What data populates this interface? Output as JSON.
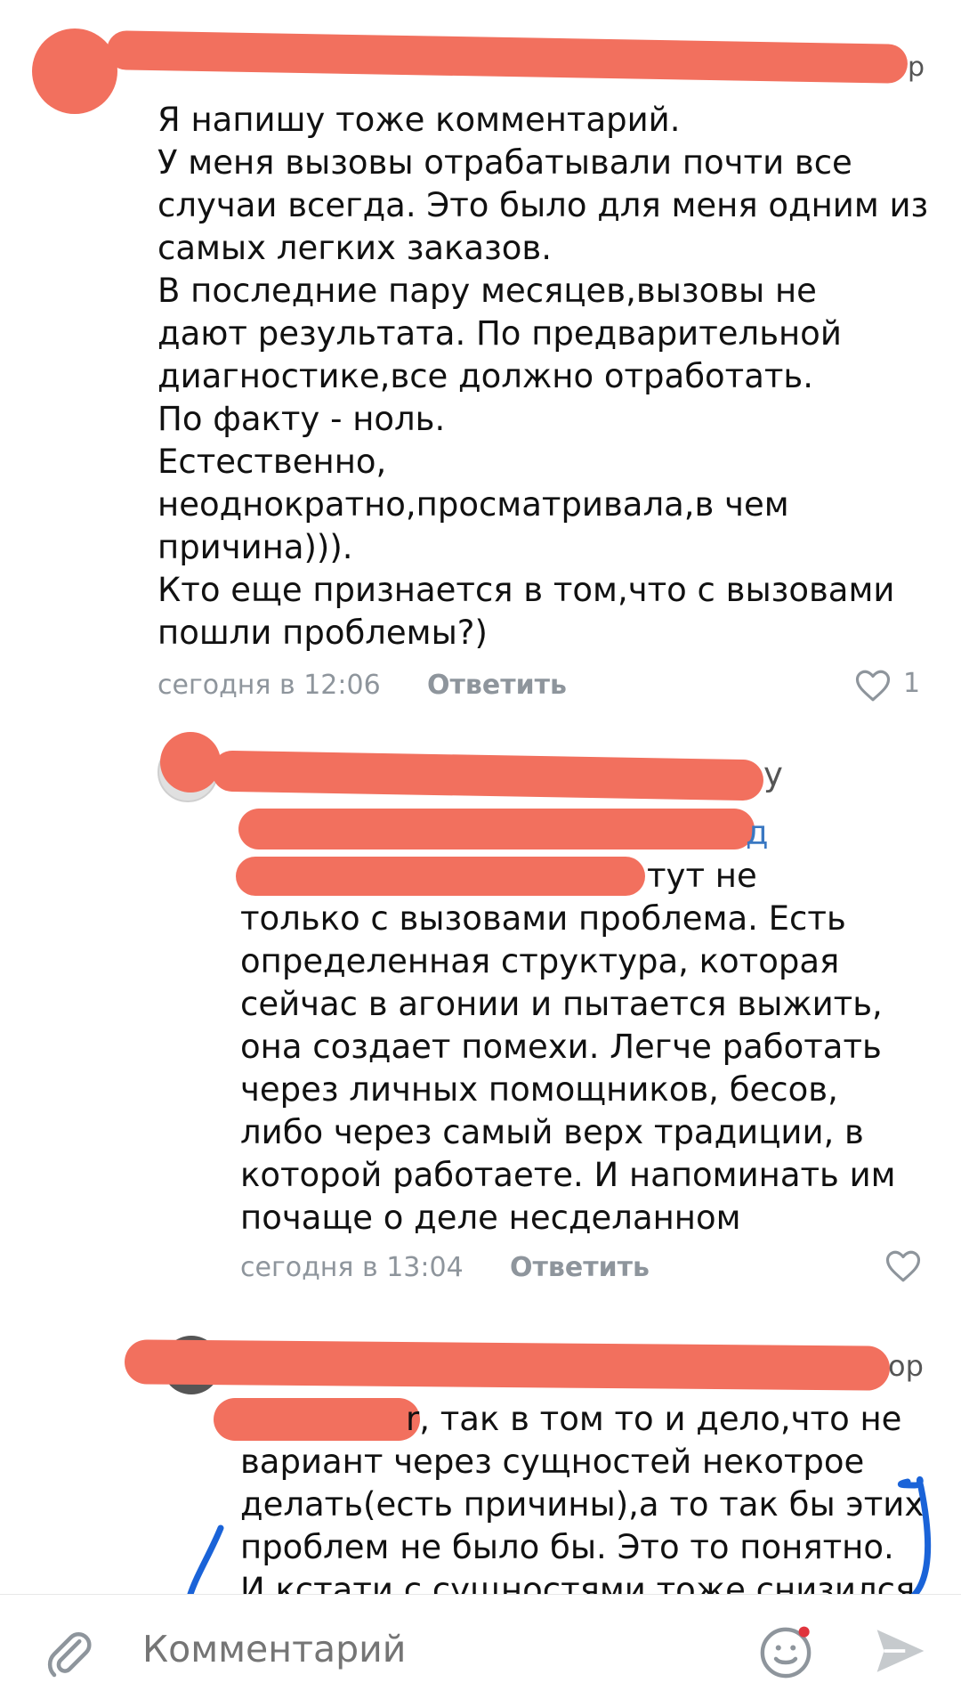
{
  "colors": {
    "redaction": "#f2705e",
    "meta": "#8e959c",
    "annotation": "#1a63d8",
    "heart": "#8e959c"
  },
  "comments": [
    {
      "author_suffix": "р",
      "text_lines": [
        "Я напишу тоже комментарий.",
        "У меня вызовы отрабатывали почти все",
        "случаи всегда. Это было для меня одним из",
        "самых легких заказов.",
        "В последние пару месяцев,вызовы не",
        "дают результата. По предварительной",
        "диагностике,все должно отработать.",
        "По факту - ноль.",
        "Естественно,",
        "неоднократно,просматривала,в чем",
        "причина))).",
        "Кто еще признается в том,что с вызовами",
        "пошли проблемы?)"
      ],
      "time": "сегодня в 12:06",
      "reply_label": "Ответить",
      "likes": "1"
    },
    {
      "author_suffix": "у",
      "line2_suffix": "д",
      "text_lines": [
        "тут не",
        "только с вызовами проблема. Есть",
        "определенная структура, которая",
        "сейчас в агонии и пытается выжить,",
        "она создает помехи. Легче работать",
        "через личных помощников, бесов,",
        "либо через самый верх традиции, в",
        "которой работаете. И напоминать им",
        "почаще о деле несделанном"
      ],
      "time": "сегодня в 13:04",
      "reply_label": "Ответить"
    },
    {
      "author_suffix": "ор",
      "text_lines": [
        "r, так в том то и дело,что не",
        "вариант через сущностей некотрое",
        "делать(есть причины),а то так бы этих",
        "проблем не было бы. Это то понятно.",
        "И кстати с сущностями тоже снизился"
      ]
    }
  ],
  "composer": {
    "placeholder": "Комментарий",
    "icons": [
      "paperclip-icon",
      "sticker-smile-icon",
      "send-icon"
    ]
  }
}
